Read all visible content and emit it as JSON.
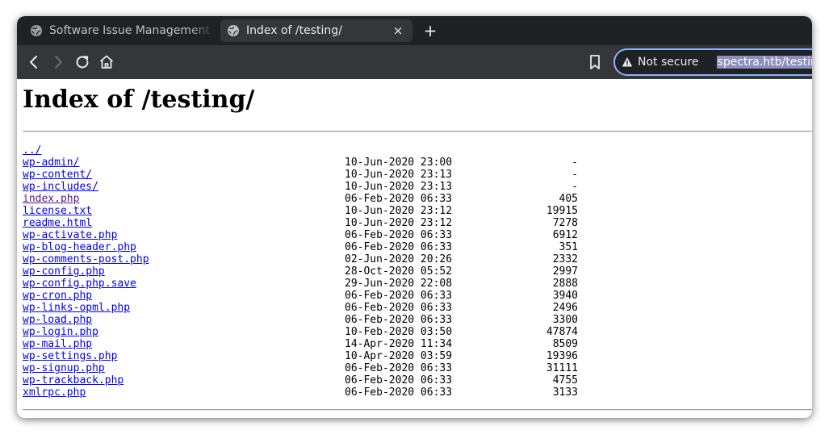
{
  "tabs": [
    {
      "title": "Software Issue Management - ",
      "active": false
    },
    {
      "title": "Index of /testing/",
      "active": true,
      "close": "×"
    }
  ],
  "new_tab_label": "+",
  "address_bar": {
    "security_label": "Not secure",
    "url": "spectra.htb/testing/"
  },
  "page": {
    "heading": "Index of /testing/",
    "parent_link": "../",
    "entries": [
      {
        "name": "wp-admin/",
        "date": "10-Jun-2020 23:00",
        "size": "-"
      },
      {
        "name": "wp-content/",
        "date": "10-Jun-2020 23:13",
        "size": "-"
      },
      {
        "name": "wp-includes/",
        "date": "10-Jun-2020 23:13",
        "size": "-"
      },
      {
        "name": "index.php",
        "date": "06-Feb-2020 06:33",
        "size": "405",
        "visited": true
      },
      {
        "name": "license.txt",
        "date": "10-Jun-2020 23:12",
        "size": "19915"
      },
      {
        "name": "readme.html",
        "date": "10-Jun-2020 23:12",
        "size": "7278"
      },
      {
        "name": "wp-activate.php",
        "date": "06-Feb-2020 06:33",
        "size": "6912"
      },
      {
        "name": "wp-blog-header.php",
        "date": "06-Feb-2020 06:33",
        "size": "351"
      },
      {
        "name": "wp-comments-post.php",
        "date": "02-Jun-2020 20:26",
        "size": "2332"
      },
      {
        "name": "wp-config.php",
        "date": "28-Oct-2020 05:52",
        "size": "2997"
      },
      {
        "name": "wp-config.php.save",
        "date": "29-Jun-2020 22:08",
        "size": "2888"
      },
      {
        "name": "wp-cron.php",
        "date": "06-Feb-2020 06:33",
        "size": "3940"
      },
      {
        "name": "wp-links-opml.php",
        "date": "06-Feb-2020 06:33",
        "size": "2496"
      },
      {
        "name": "wp-load.php",
        "date": "06-Feb-2020 06:33",
        "size": "3300"
      },
      {
        "name": "wp-login.php",
        "date": "10-Feb-2020 03:50",
        "size": "47874"
      },
      {
        "name": "wp-mail.php",
        "date": "14-Apr-2020 11:34",
        "size": "8509"
      },
      {
        "name": "wp-settings.php",
        "date": "10-Apr-2020 03:59",
        "size": "19396"
      },
      {
        "name": "wp-signup.php",
        "date": "06-Feb-2020 06:33",
        "size": "31111"
      },
      {
        "name": "wp-trackback.php",
        "date": "06-Feb-2020 06:33",
        "size": "4755"
      },
      {
        "name": "xmlrpc.php",
        "date": "06-Feb-2020 06:33",
        "size": "3133"
      }
    ]
  },
  "icons": [
    "globe-icon",
    "back-icon",
    "forward-icon",
    "reload-icon",
    "home-icon",
    "bookmark-icon",
    "warning-icon"
  ],
  "colors": {
    "link": "#0000ee",
    "visited_link": "#551a8b",
    "focus_ring": "#8ab4f8",
    "url_selection": "#8a8fbd"
  }
}
